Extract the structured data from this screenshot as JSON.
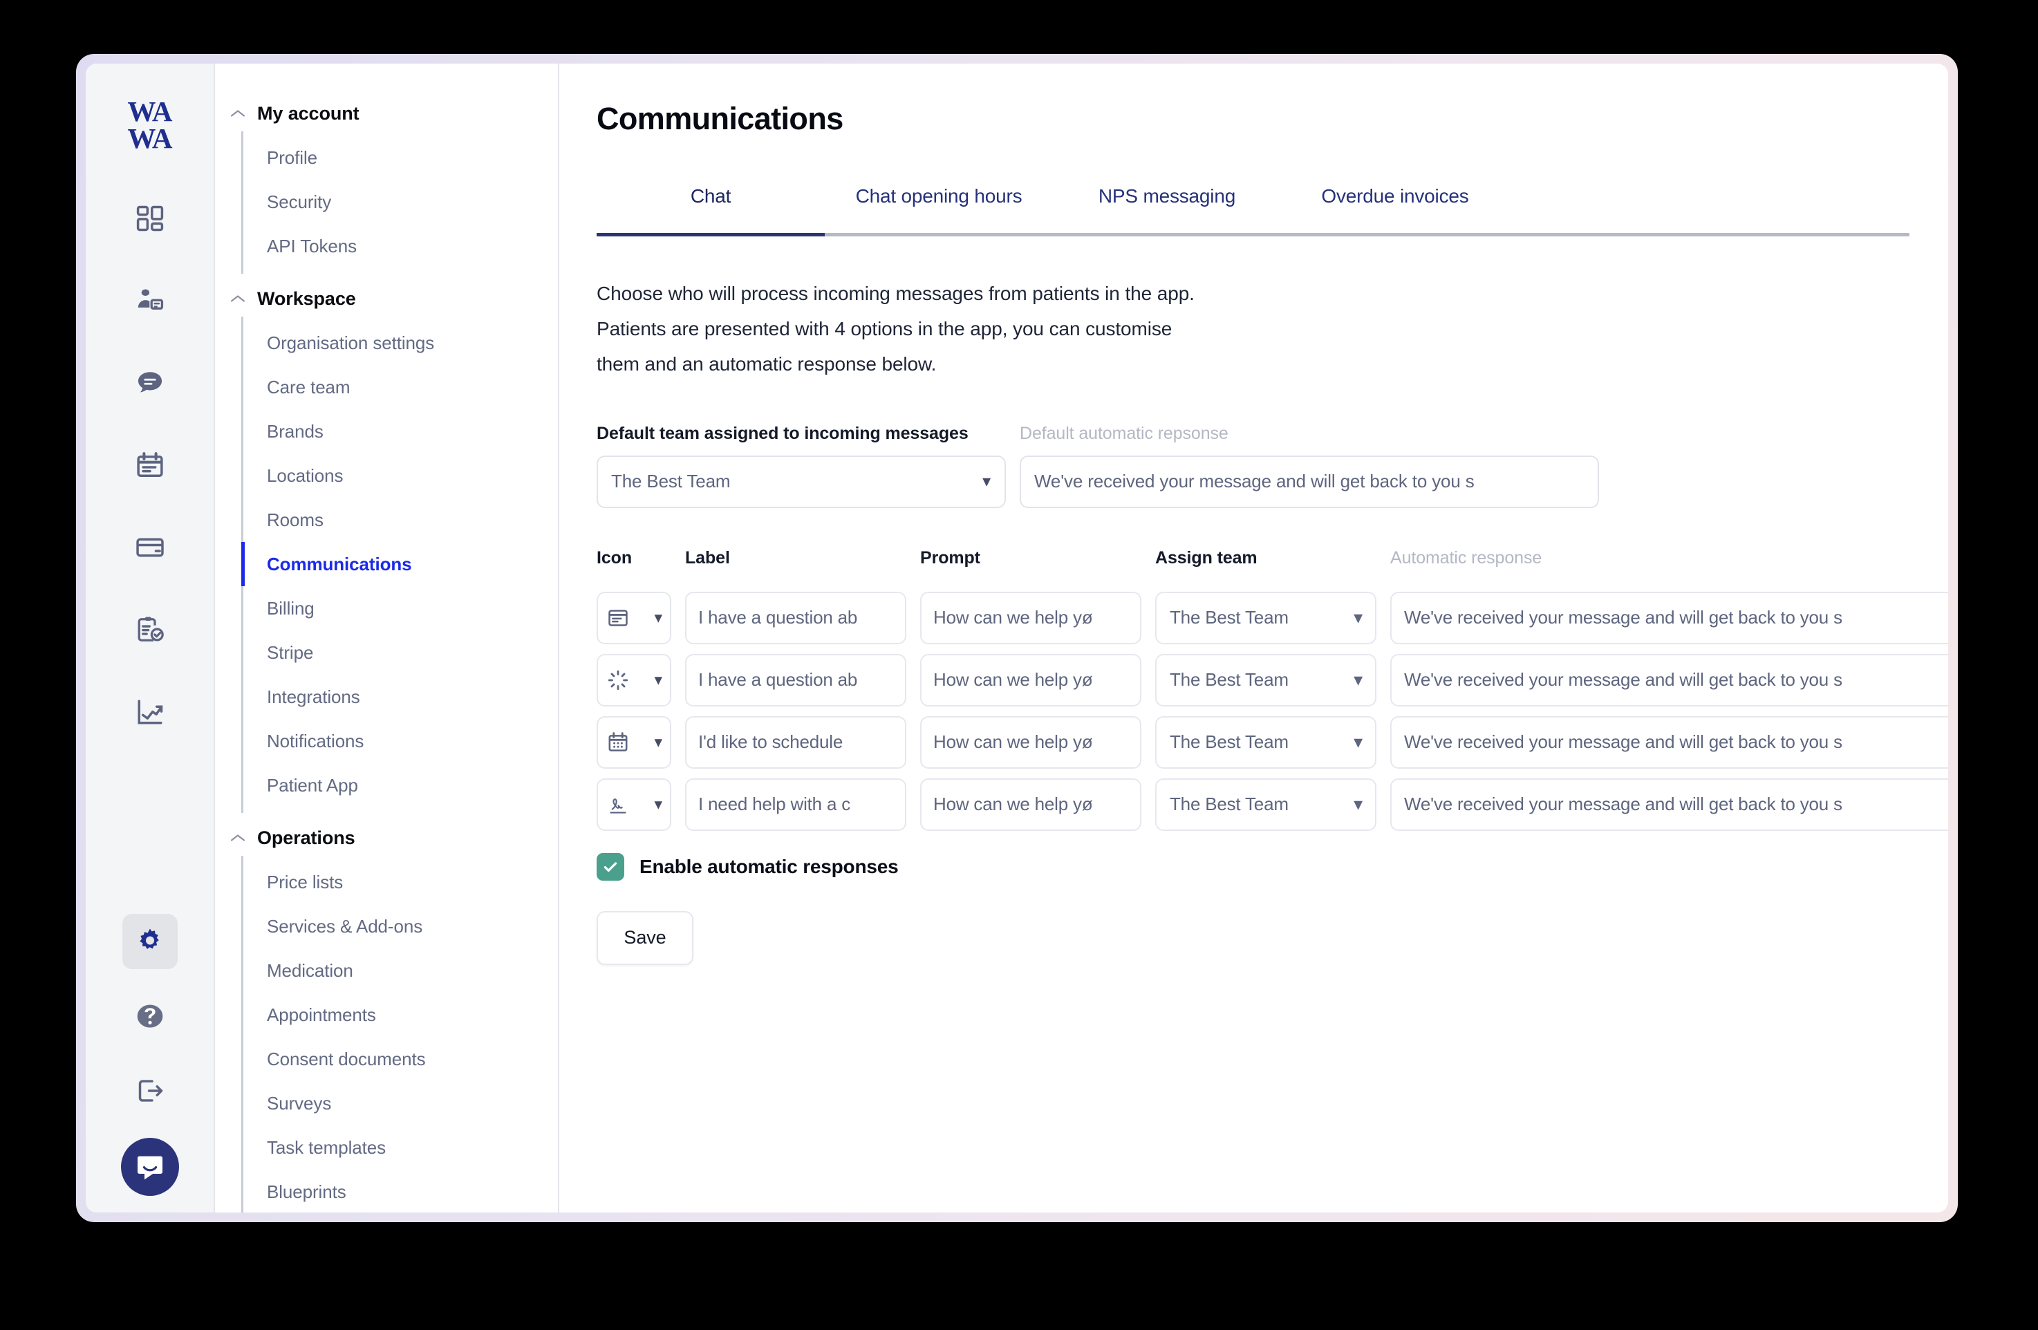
{
  "brand": {
    "logo_line1": "WA",
    "logo_line2": "WA",
    "logo_color": "#1f2f8f",
    "accent_color": "#1a2ae8",
    "tab_accent_color": "#2b3573",
    "checkbox_color": "#4aa08c"
  },
  "rail": {
    "icons": [
      {
        "name": "dashboard-icon"
      },
      {
        "name": "patient-record-icon"
      },
      {
        "name": "chat-icon"
      },
      {
        "name": "calendar-icon"
      },
      {
        "name": "card-icon"
      },
      {
        "name": "clipboard-check-icon"
      },
      {
        "name": "analytics-icon"
      }
    ],
    "bottom_icons": [
      {
        "name": "gear-icon",
        "active": true
      },
      {
        "name": "help-icon",
        "active": false
      },
      {
        "name": "logout-icon",
        "active": false
      }
    ],
    "support_bubble": "intercom-icon"
  },
  "sidebar": {
    "groups": [
      {
        "label": "My account",
        "items": [
          {
            "label": "Profile",
            "active": false
          },
          {
            "label": "Security",
            "active": false
          },
          {
            "label": "API Tokens",
            "active": false
          }
        ]
      },
      {
        "label": "Workspace",
        "items": [
          {
            "label": "Organisation settings",
            "active": false
          },
          {
            "label": "Care team",
            "active": false
          },
          {
            "label": "Brands",
            "active": false
          },
          {
            "label": "Locations",
            "active": false
          },
          {
            "label": "Rooms",
            "active": false
          },
          {
            "label": "Communications",
            "active": true
          },
          {
            "label": "Billing",
            "active": false
          },
          {
            "label": "Stripe",
            "active": false
          },
          {
            "label": "Integrations",
            "active": false
          },
          {
            "label": "Notifications",
            "active": false
          },
          {
            "label": "Patient App",
            "active": false
          }
        ]
      },
      {
        "label": "Operations",
        "items": [
          {
            "label": "Price lists",
            "active": false
          },
          {
            "label": "Services & Add-ons",
            "active": false
          },
          {
            "label": "Medication",
            "active": false
          },
          {
            "label": "Appointments",
            "active": false
          },
          {
            "label": "Consent documents",
            "active": false
          },
          {
            "label": "Surveys",
            "active": false
          },
          {
            "label": "Task templates",
            "active": false
          },
          {
            "label": "Blueprints",
            "active": false
          }
        ]
      }
    ]
  },
  "page": {
    "title": "Communications",
    "tabs": [
      {
        "label": "Chat",
        "active": true
      },
      {
        "label": "Chat opening hours",
        "active": false
      },
      {
        "label": "NPS messaging",
        "active": false
      },
      {
        "label": "Overdue invoices",
        "active": false
      }
    ],
    "intro_line1": "Choose who will process incoming messages from patients in the app.",
    "intro_line2": "Patients are presented with 4 options in the app, you can customise",
    "intro_line3": "them and an automatic response below."
  },
  "defaults": {
    "team_label": "Default team assigned to incoming messages",
    "team_value": "The Best Team",
    "response_label": "Default automatic repsonse",
    "response_value": "We've received your message and will get back to you s"
  },
  "grid": {
    "headers": {
      "icon": "Icon",
      "label": "Label",
      "prompt": "Prompt",
      "team": "Assign team",
      "auto": "Automatic response"
    },
    "rows": [
      {
        "icon_name": "invoice-card-icon",
        "label": "I have a question ab",
        "prompt": "How can we help yø",
        "team": "The Best Team",
        "auto": "We've received your message and will get back to you s"
      },
      {
        "icon_name": "spinner-icon",
        "label": "I have a question ab",
        "prompt": "How can we help yø",
        "team": "The Best Team",
        "auto": "We've received your message and will get back to you s"
      },
      {
        "icon_name": "calendar-icon",
        "label": "I'd like to schedule",
        "prompt": "How can we help yø",
        "team": "The Best Team",
        "auto": "We've received your message and will get back to you s"
      },
      {
        "icon_name": "signature-icon",
        "label": "I need help with a c",
        "prompt": "How can we help yø",
        "team": "The Best Team",
        "auto": "We've received your message and will get back to you s"
      }
    ]
  },
  "footer": {
    "enable_label": "Enable automatic responses",
    "enable_checked": true,
    "save_label": "Save"
  }
}
